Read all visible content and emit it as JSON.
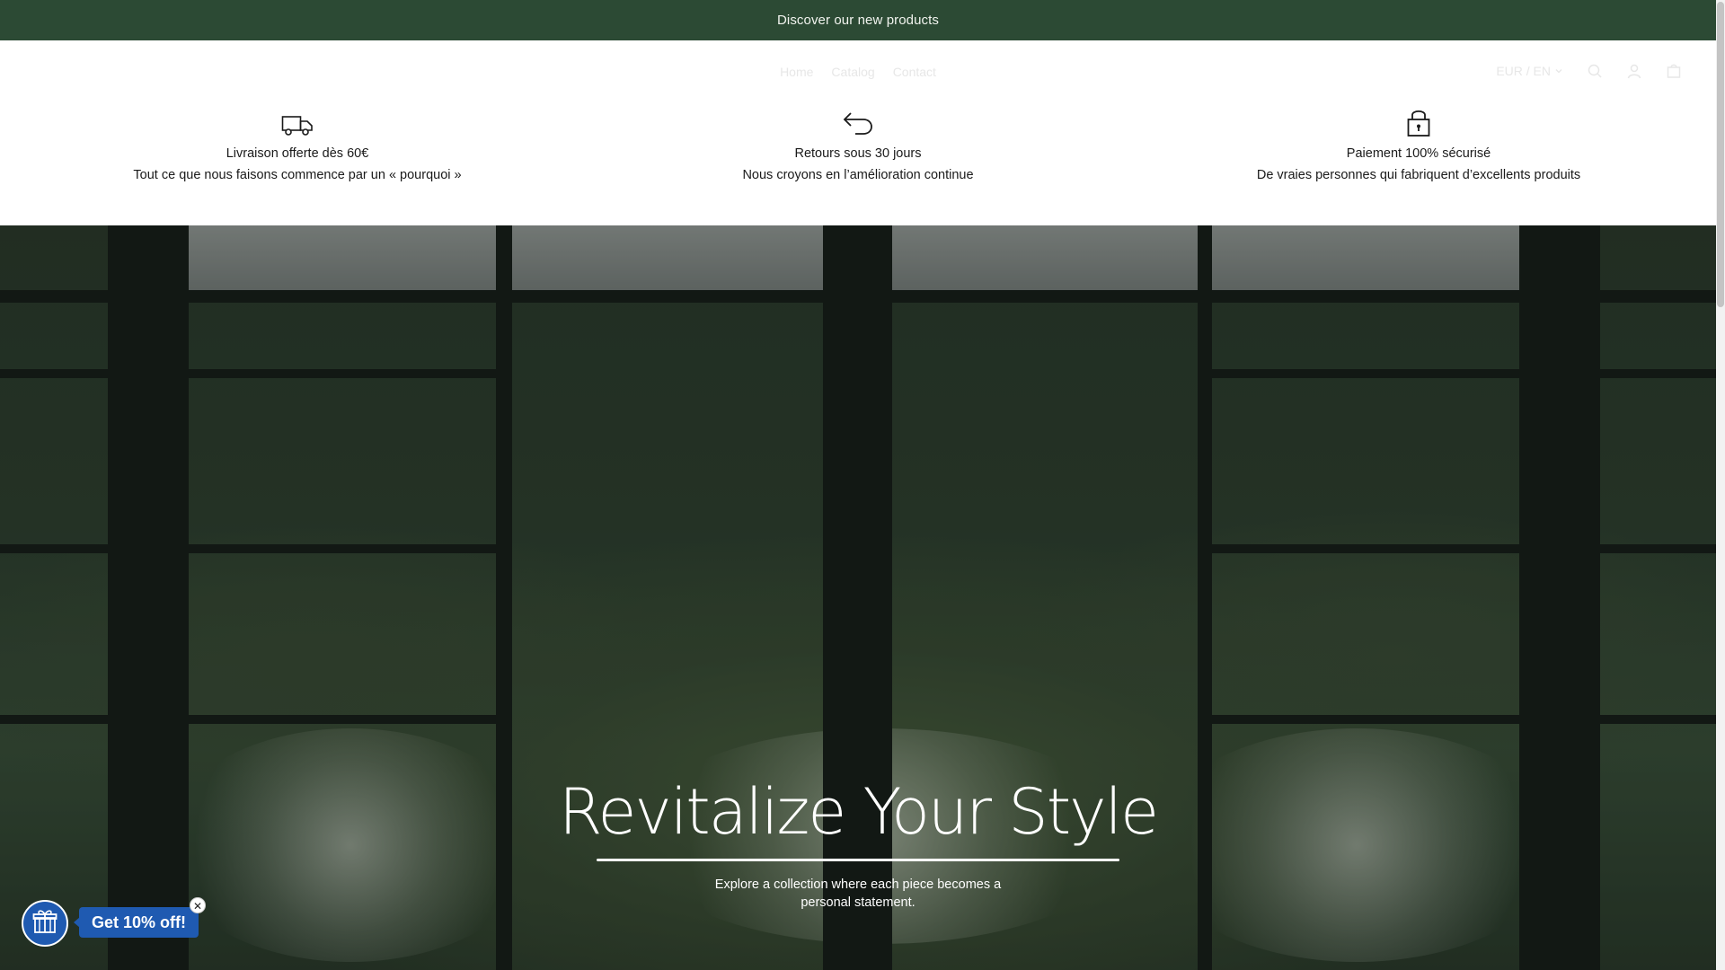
{
  "announcement": {
    "text": "Discover our new products"
  },
  "nav": {
    "items": [
      {
        "label": "Home"
      },
      {
        "label": "Catalog"
      },
      {
        "label": "Contact"
      }
    ],
    "currency_selector": "EUR / EN",
    "icons": [
      "search-icon",
      "account-icon",
      "cart-icon"
    ]
  },
  "features": [
    {
      "icon": "truck-icon",
      "title": "Livraison offerte dès 60€",
      "subtitle": "Tout ce que nous faisons commence par un « pourquoi »"
    },
    {
      "icon": "return-arrow-icon",
      "title": "Retours sous 30 jours",
      "subtitle": "Nous croyons en l’amélioration continue"
    },
    {
      "icon": "lock-icon",
      "title": "Paiement 100% sécurisé",
      "subtitle": "De vraies personnes qui fabriquent d’excellents produits"
    }
  ],
  "hero": {
    "title": "Revitalize Your Style",
    "subtitle_line1": "Explore a collection where each piece becomes a",
    "subtitle_line2": "personal statement."
  },
  "promo": {
    "label": "Get 10% off!",
    "close_symbol": "✕",
    "icon": "gift-icon"
  },
  "colors": {
    "announcement_bg": "#2c4a34",
    "promo_bg": "#1f5ab1"
  }
}
